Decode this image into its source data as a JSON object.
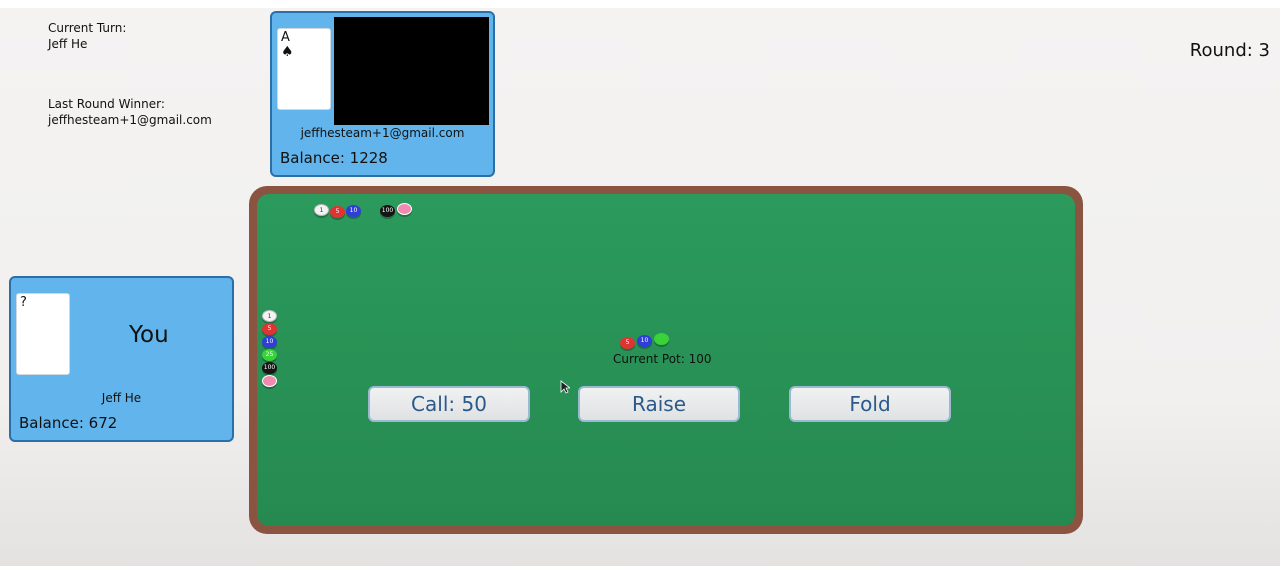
{
  "status": {
    "current_turn_label": "Current Turn:",
    "current_turn_value": "Jeff He",
    "last_winner_label": "Last Round Winner:",
    "last_winner_value": "jeffhesteam+1@gmail.com",
    "round": "Round: 3"
  },
  "opponent": {
    "card_rank": "A",
    "card_suit": "♠",
    "email": "jeffhesteam+1@gmail.com",
    "balance": "Balance: 1228"
  },
  "you": {
    "card_value": "?",
    "label": "You",
    "name": "Jeff He",
    "balance": "Balance: 672"
  },
  "table": {
    "opponent_chips": [
      "1",
      "5",
      "10",
      "100",
      ""
    ],
    "you_chips": [
      "1",
      "5",
      "10",
      "25",
      "100",
      ""
    ],
    "pot_chips": [
      "5",
      "10",
      ""
    ],
    "pot_label": "Current Pot: 100"
  },
  "actions": {
    "call": "Call: 50",
    "raise": "Raise",
    "fold": "Fold"
  },
  "colors": {
    "felt": "#2b9a5c",
    "rim": "#8a5440",
    "panel": "#62b5ec",
    "button_text": "#2b5a8a"
  }
}
